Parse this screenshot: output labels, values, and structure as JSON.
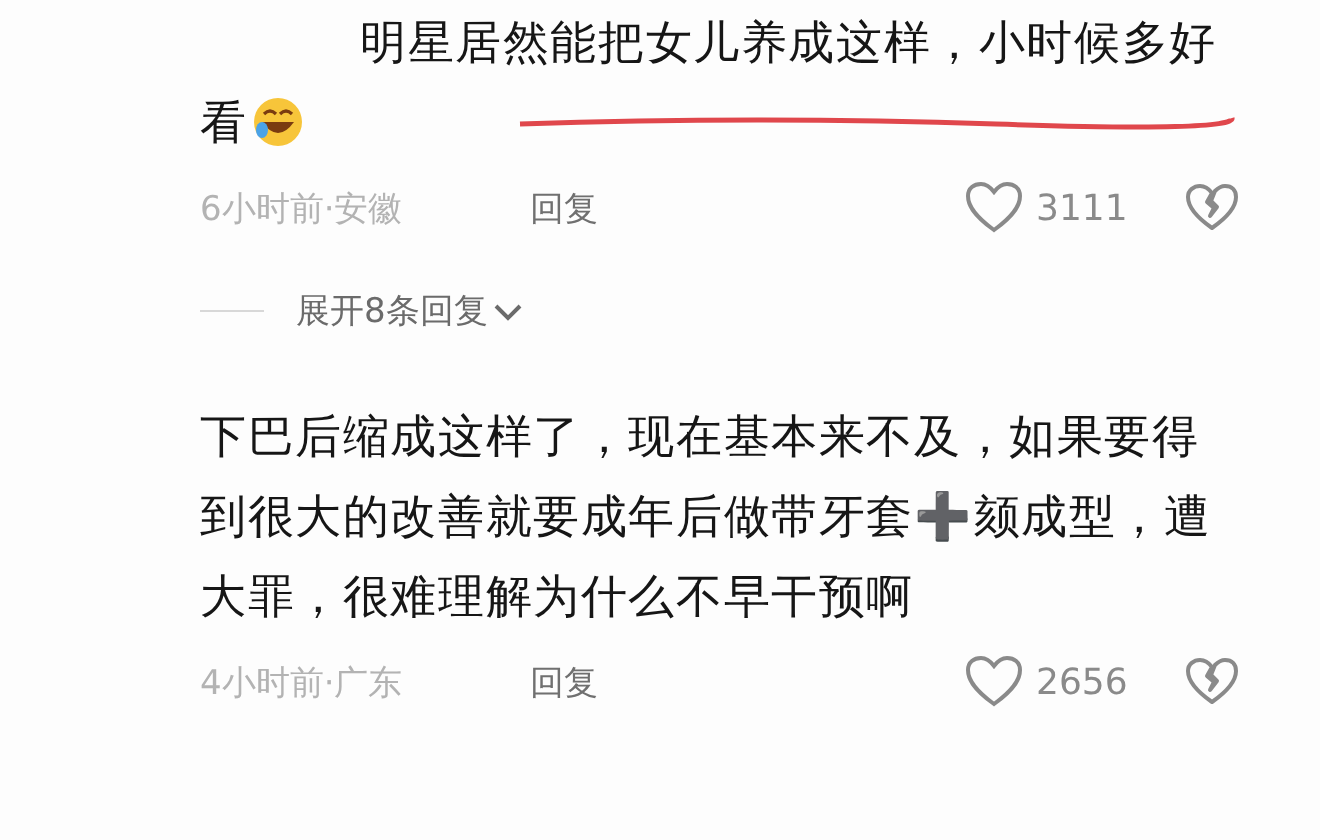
{
  "comments": [
    {
      "text": "明星居然能把女儿养成这样，小时候多好看",
      "emoji_after": true,
      "underlined": true,
      "time_place": "6小时前·安徽",
      "reply": "回复",
      "likes": "3111",
      "expand": "展开8条回复"
    },
    {
      "text": "下巴后缩成这样了，现在基本来不及，如果要得到很大的改善就要成年后做带牙套➕颏成型，遭大罪，很难理解为什么不早干预啊",
      "emoji_after": false,
      "underlined": false,
      "time_place": "4小时前·广东",
      "reply": "回复",
      "likes": "2656"
    }
  ]
}
